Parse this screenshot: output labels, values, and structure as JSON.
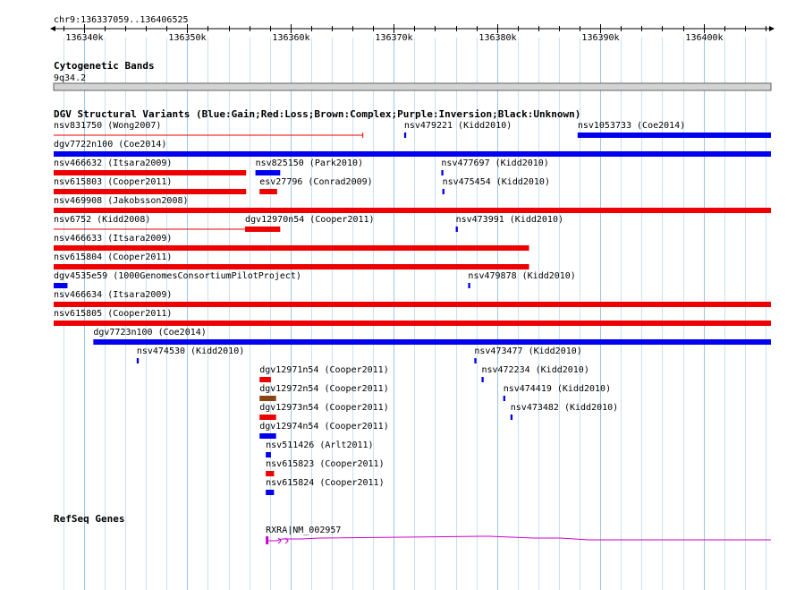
{
  "browser": {
    "region_label": "chr9:136337059..136406525",
    "coordinate_range": [
      136337059,
      136406525
    ],
    "ruler_ticks": [
      {
        "value": 136340000,
        "label": "136340k"
      },
      {
        "value": 136350000,
        "label": "136350k"
      },
      {
        "value": 136360000,
        "label": "136360k"
      },
      {
        "value": 136370000,
        "label": "136370k"
      },
      {
        "value": 136380000,
        "label": "136380k"
      },
      {
        "value": 136390000,
        "label": "136390k"
      },
      {
        "value": 136400000,
        "label": "136400k"
      }
    ]
  },
  "tracks": {
    "cytobands": {
      "title": "Cytogenetic Bands",
      "band_label": "9q34.2"
    },
    "dgv": {
      "title": "DGV Structural Variants (Blue:Gain;Red:Loss;Brown:Complex;Purple:Inversion;Black:Unknown)",
      "colors": {
        "gain": "#0000ee",
        "loss": "#ee0000",
        "complex": "#8b4513",
        "inversion": "#800080",
        "unknown": "#000000"
      },
      "features": [
        {
          "label": "nsv831750 (Wong2007)",
          "type": "loss",
          "start": 136337059,
          "end": 136367000,
          "style": "thin"
        },
        {
          "label": "nsv479221 (Kidd2010)",
          "type": "gain",
          "start": 136371000,
          "end": 136371200
        },
        {
          "label": "nsv1053733 (Coe2014)",
          "type": "gain",
          "start": 136387800,
          "end": 136406525
        },
        {
          "label": "dgv7722n100 (Coe2014)",
          "type": "gain",
          "start": 136337059,
          "end": 136406525
        },
        {
          "label": "nsv466632 (Itsara2009)",
          "type": "loss",
          "start": 136337059,
          "end": 136355700
        },
        {
          "label": "nsv825150 (Park2010)",
          "type": "gain",
          "start": 136356600,
          "end": 136359000
        },
        {
          "label": "nsv477697 (Kidd2010)",
          "type": "gain",
          "start": 136374600,
          "end": 136374800
        },
        {
          "label": "nsv615803 (Cooper2011)",
          "type": "loss",
          "start": 136337059,
          "end": 136355700
        },
        {
          "label": "esv27796 (Conrad2009)",
          "type": "loss",
          "start": 136357000,
          "end": 136358700
        },
        {
          "label": "nsv475454 (Kidd2010)",
          "type": "gain",
          "start": 136374700,
          "end": 136374900
        },
        {
          "label": "nsv469908 (Jakobsson2008)",
          "type": "loss",
          "start": 136337059,
          "end": 136406525
        },
        {
          "label": "nsv6752 (Kidd2008)",
          "type": "loss",
          "start": 136337059,
          "end": 136355700,
          "style": "thin"
        },
        {
          "label": "dgv12970n54 (Cooper2011)",
          "type": "loss",
          "start": 136355600,
          "end": 136359000
        },
        {
          "label": "nsv473991 (Kidd2010)",
          "type": "gain",
          "start": 136376000,
          "end": 136376200
        },
        {
          "label": "nsv466633 (Itsara2009)",
          "type": "loss",
          "start": 136337059,
          "end": 136383100
        },
        {
          "label": "nsv615804 (Cooper2011)",
          "type": "loss",
          "start": 136337059,
          "end": 136383100
        },
        {
          "label": "dgv4535e59 (1000GenomesConsortiumPilotProject)",
          "type": "gain",
          "start": 136337059,
          "end": 136338400
        },
        {
          "label": "nsv479878 (Kidd2010)",
          "type": "gain",
          "start": 136377200,
          "end": 136377400
        },
        {
          "label": "nsv466634 (Itsara2009)",
          "type": "loss",
          "start": 136337059,
          "end": 136406525
        },
        {
          "label": "nsv615805 (Cooper2011)",
          "type": "loss",
          "start": 136337059,
          "end": 136406525
        },
        {
          "label": "dgv7723n100 (Coe2014)",
          "type": "gain",
          "start": 136340900,
          "end": 136406525
        },
        {
          "label": "nsv474530 (Kidd2010)",
          "type": "gain",
          "start": 136345100,
          "end": 136345300
        },
        {
          "label": "nsv473477 (Kidd2010)",
          "type": "gain",
          "start": 136377800,
          "end": 136378000
        },
        {
          "label": "dgv12971n54 (Cooper2011)",
          "type": "loss",
          "start": 136357000,
          "end": 136358100
        },
        {
          "label": "nsv472234 (Kidd2010)",
          "type": "gain",
          "start": 136378500,
          "end": 136378700
        },
        {
          "label": "dgv12972n54 (Cooper2011)",
          "type": "complex",
          "start": 136357000,
          "end": 136358600
        },
        {
          "label": "nsv474419 (Kidd2010)",
          "type": "gain",
          "start": 136380600,
          "end": 136380800
        },
        {
          "label": "dgv12973n54 (Cooper2011)",
          "type": "loss",
          "start": 136357000,
          "end": 136358600
        },
        {
          "label": "nsv473482 (Kidd2010)",
          "type": "gain",
          "start": 136381300,
          "end": 136381500
        },
        {
          "label": "dgv12974n54 (Cooper2011)",
          "type": "gain",
          "start": 136357000,
          "end": 136358600
        },
        {
          "label": "nsv511426 (Arlt2011)",
          "type": "gain",
          "start": 136357600,
          "end": 136358100
        },
        {
          "label": "nsv615823 (Cooper2011)",
          "type": "loss",
          "start": 136357600,
          "end": 136358400
        },
        {
          "label": "nsv615824 (Cooper2011)",
          "type": "gain",
          "start": 136357600,
          "end": 136358400
        }
      ]
    },
    "refseq": {
      "title": "RefSeq Genes",
      "gene_label": "RXRA|NM_002957",
      "start": 136357600,
      "end": 136406525,
      "color": "#cc00cc"
    }
  }
}
